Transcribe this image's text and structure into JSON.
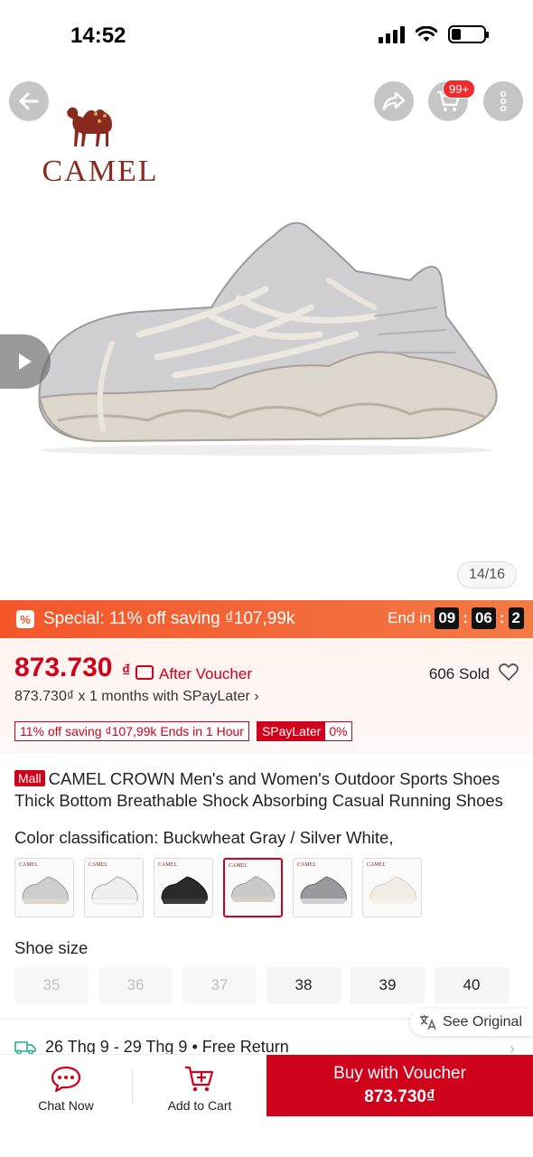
{
  "status_bar": {
    "time": "14:52"
  },
  "header": {
    "brand_logo": "CAMEL",
    "cart_badge": "99+",
    "icons": [
      "back-arrow-icon",
      "share-icon",
      "cart-icon",
      "more-vertical-icon",
      "play-icon"
    ],
    "image_counter": "14/16"
  },
  "promo": {
    "icon": "%",
    "text": "Special: 11% off saving ₫107,99k",
    "end_label": "End in",
    "hours": "09",
    "minutes": "06",
    "seconds": "2"
  },
  "price": {
    "amount": "873.730",
    "currency": "₫",
    "after_voucher": "After Voucher",
    "sold": "606 Sold",
    "spaylater": "873.730₫ x 1 months with SPayLater ›",
    "tag_discount": "11% off saving ₫107,99k Ends in 1 Hour",
    "tag_spay_left": "SPayLater",
    "tag_spay_right": "0%"
  },
  "product": {
    "mall_badge": "Mall",
    "title": "CAMEL CROWN Men's and Women's Outdoor Sports Shoes Thick Bottom Breathable Shock Absorbing Casual Running Shoes"
  },
  "color": {
    "label": "Color classification:",
    "value": " Buckwheat Gray / Silver White,",
    "swatch_logo": "CAMEL",
    "selected_index": 3
  },
  "size": {
    "label": "Shoe size",
    "options": [
      "35",
      "36",
      "37",
      "38",
      "39",
      "40"
    ]
  },
  "translate": {
    "label": "See Original"
  },
  "shipping": {
    "text": "26 Thg 9 - 29 Thg 9 • Free Return"
  },
  "bottom_bar": {
    "chat": "Chat Now",
    "add_to_cart": "Add to Cart",
    "buy_label": "Buy with Voucher",
    "buy_price": "873.730₫"
  },
  "colors": {
    "accent": "#d0011b",
    "promo": "#f4562a"
  }
}
